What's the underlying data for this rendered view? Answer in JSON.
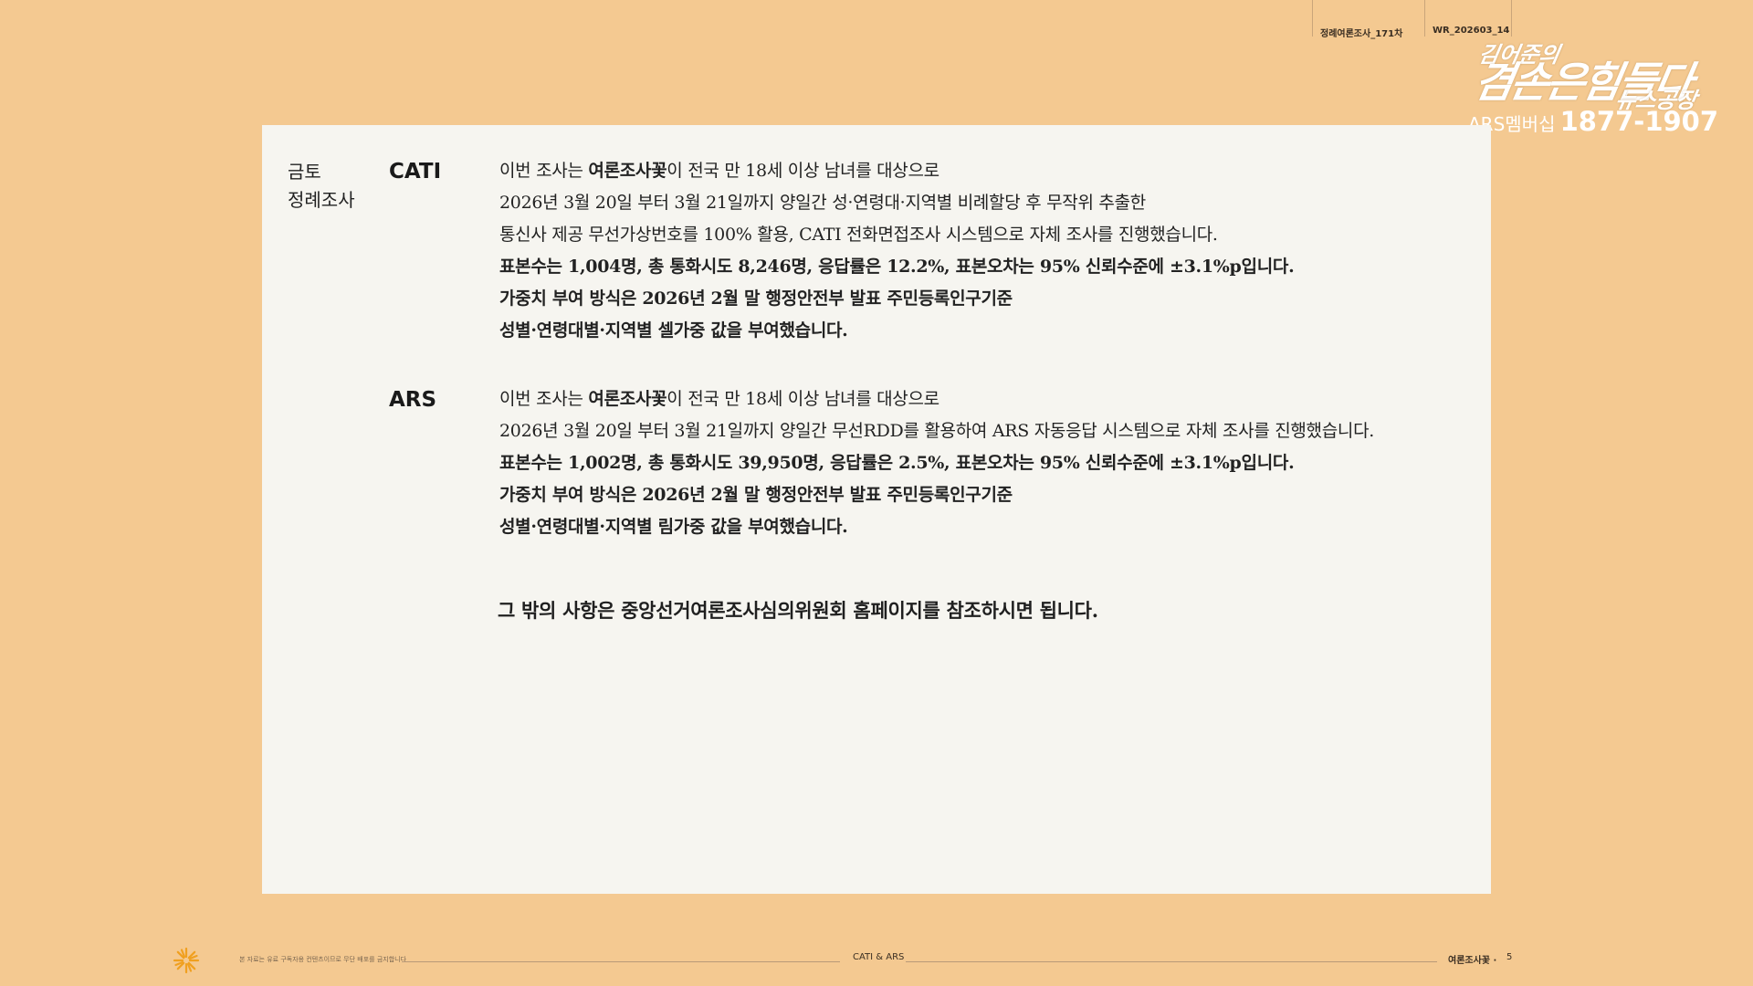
{
  "header": {
    "tab_survey": "정례여론조사_171차",
    "tab_code": "WR_202603_14"
  },
  "logo": {
    "line1": "김어준의",
    "line2": "겸손은힘들다",
    "line3": "뉴스공장",
    "phone_prefix": "ARS멤버십",
    "phone_number": "1877-1907"
  },
  "panel": {
    "left_label_line1": "금토",
    "left_label_line2": "정례조사",
    "cati": {
      "label": "CATI",
      "line1_a": "이번 조사는 ",
      "line1_b": "여론조사꽃",
      "line1_c": "이 전국 만 18세 이상 남녀를 대상으로",
      "line2": "2026년 3월 20일 부터 3월 21일까지 양일간 성·연령대·지역별 비례할당 후 무작위 추출한",
      "line3": "통신사 제공 무선가상번호를 100% 활용, CATI 전화면접조사 시스템으로 자체 조사를 진행했습니다.",
      "line4": "표본수는 1,004명, 총 통화시도 8,246명, 응답률은 12.2%, 표본오차는 95% 신뢰수준에 ±3.1%p입니다.",
      "line5": "가중치 부여 방식은 2026년 2월 말 행정안전부 발표 주민등록인구기준",
      "line6": "성별·연령대별·지역별 셀가중 값을 부여했습니다."
    },
    "ars": {
      "label": "ARS",
      "line1_a": "이번 조사는 ",
      "line1_b": "여론조사꽃",
      "line1_c": "이 전국 만 18세 이상 남녀를 대상으로",
      "line2": "2026년 3월 20일 부터 3월 21일까지 양일간 무선RDD를 활용하여 ARS 자동응답 시스템으로 자체 조사를 진행했습니다.",
      "line3": "표본수는 1,002명, 총 통화시도 39,950명, 응답률은 2.5%, 표본오차는 95% 신뢰수준에 ±3.1%p입니다.",
      "line4": "가중치 부여 방식은 2026년 2월 말 행정안전부 발표 주민등록인구기준",
      "line5": "성별·연령대별·지역별 림가중 값을 부여했습니다."
    },
    "footnote": "그 밖의 사항은 중앙선거여론조사심의위원회 홈페이지를 참조하시면 됩니다."
  },
  "footer": {
    "notice": "본 자료는 유료 구독자용 컨텐츠이므로 무단 배포를 금지합니다",
    "center": "CATI & ARS",
    "brand": "여론조사꽃",
    "separator": "·",
    "page": "5"
  },
  "colors": {
    "background": "#f4c991",
    "panel": "#f6f5f0",
    "text": "#1f1f1f",
    "logo_text": "#ffffff"
  }
}
